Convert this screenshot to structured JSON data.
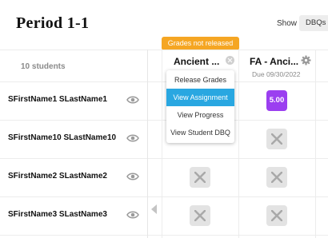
{
  "header": {
    "title": "Period 1-1",
    "show_label": "Show",
    "show_value": "DBQs a"
  },
  "students": {
    "count_label": "10 students",
    "rows": [
      {
        "name": "SFirstName1 SLastName1"
      },
      {
        "name": "SFirstName10 SLastName10"
      },
      {
        "name": "SFirstName2 SLastName2"
      },
      {
        "name": "SFirstName3 SLastName3"
      }
    ]
  },
  "assignments": [
    {
      "title": "Ancient ...",
      "status_badge": "Grades not released",
      "due": ""
    },
    {
      "title": "FA - Anci...",
      "due": "Due 09/30/2022"
    }
  ],
  "scores": [
    [
      "",
      "5.00"
    ],
    [
      "",
      ""
    ],
    [
      "",
      ""
    ],
    [
      "",
      ""
    ]
  ],
  "context_menu": {
    "items": [
      {
        "label": "Release Grades"
      },
      {
        "label": "View Assignment",
        "active": true
      },
      {
        "label": "View Progress"
      },
      {
        "label": "View Student DBQ"
      }
    ]
  },
  "colors": {
    "badge": "#f5a623",
    "graded_score": "#9b3ff0",
    "menu_active": "#29a7e1"
  },
  "icons": [
    "eye-icon",
    "close-icon",
    "gear-icon",
    "x-icon",
    "collapse-arrow-icon"
  ]
}
